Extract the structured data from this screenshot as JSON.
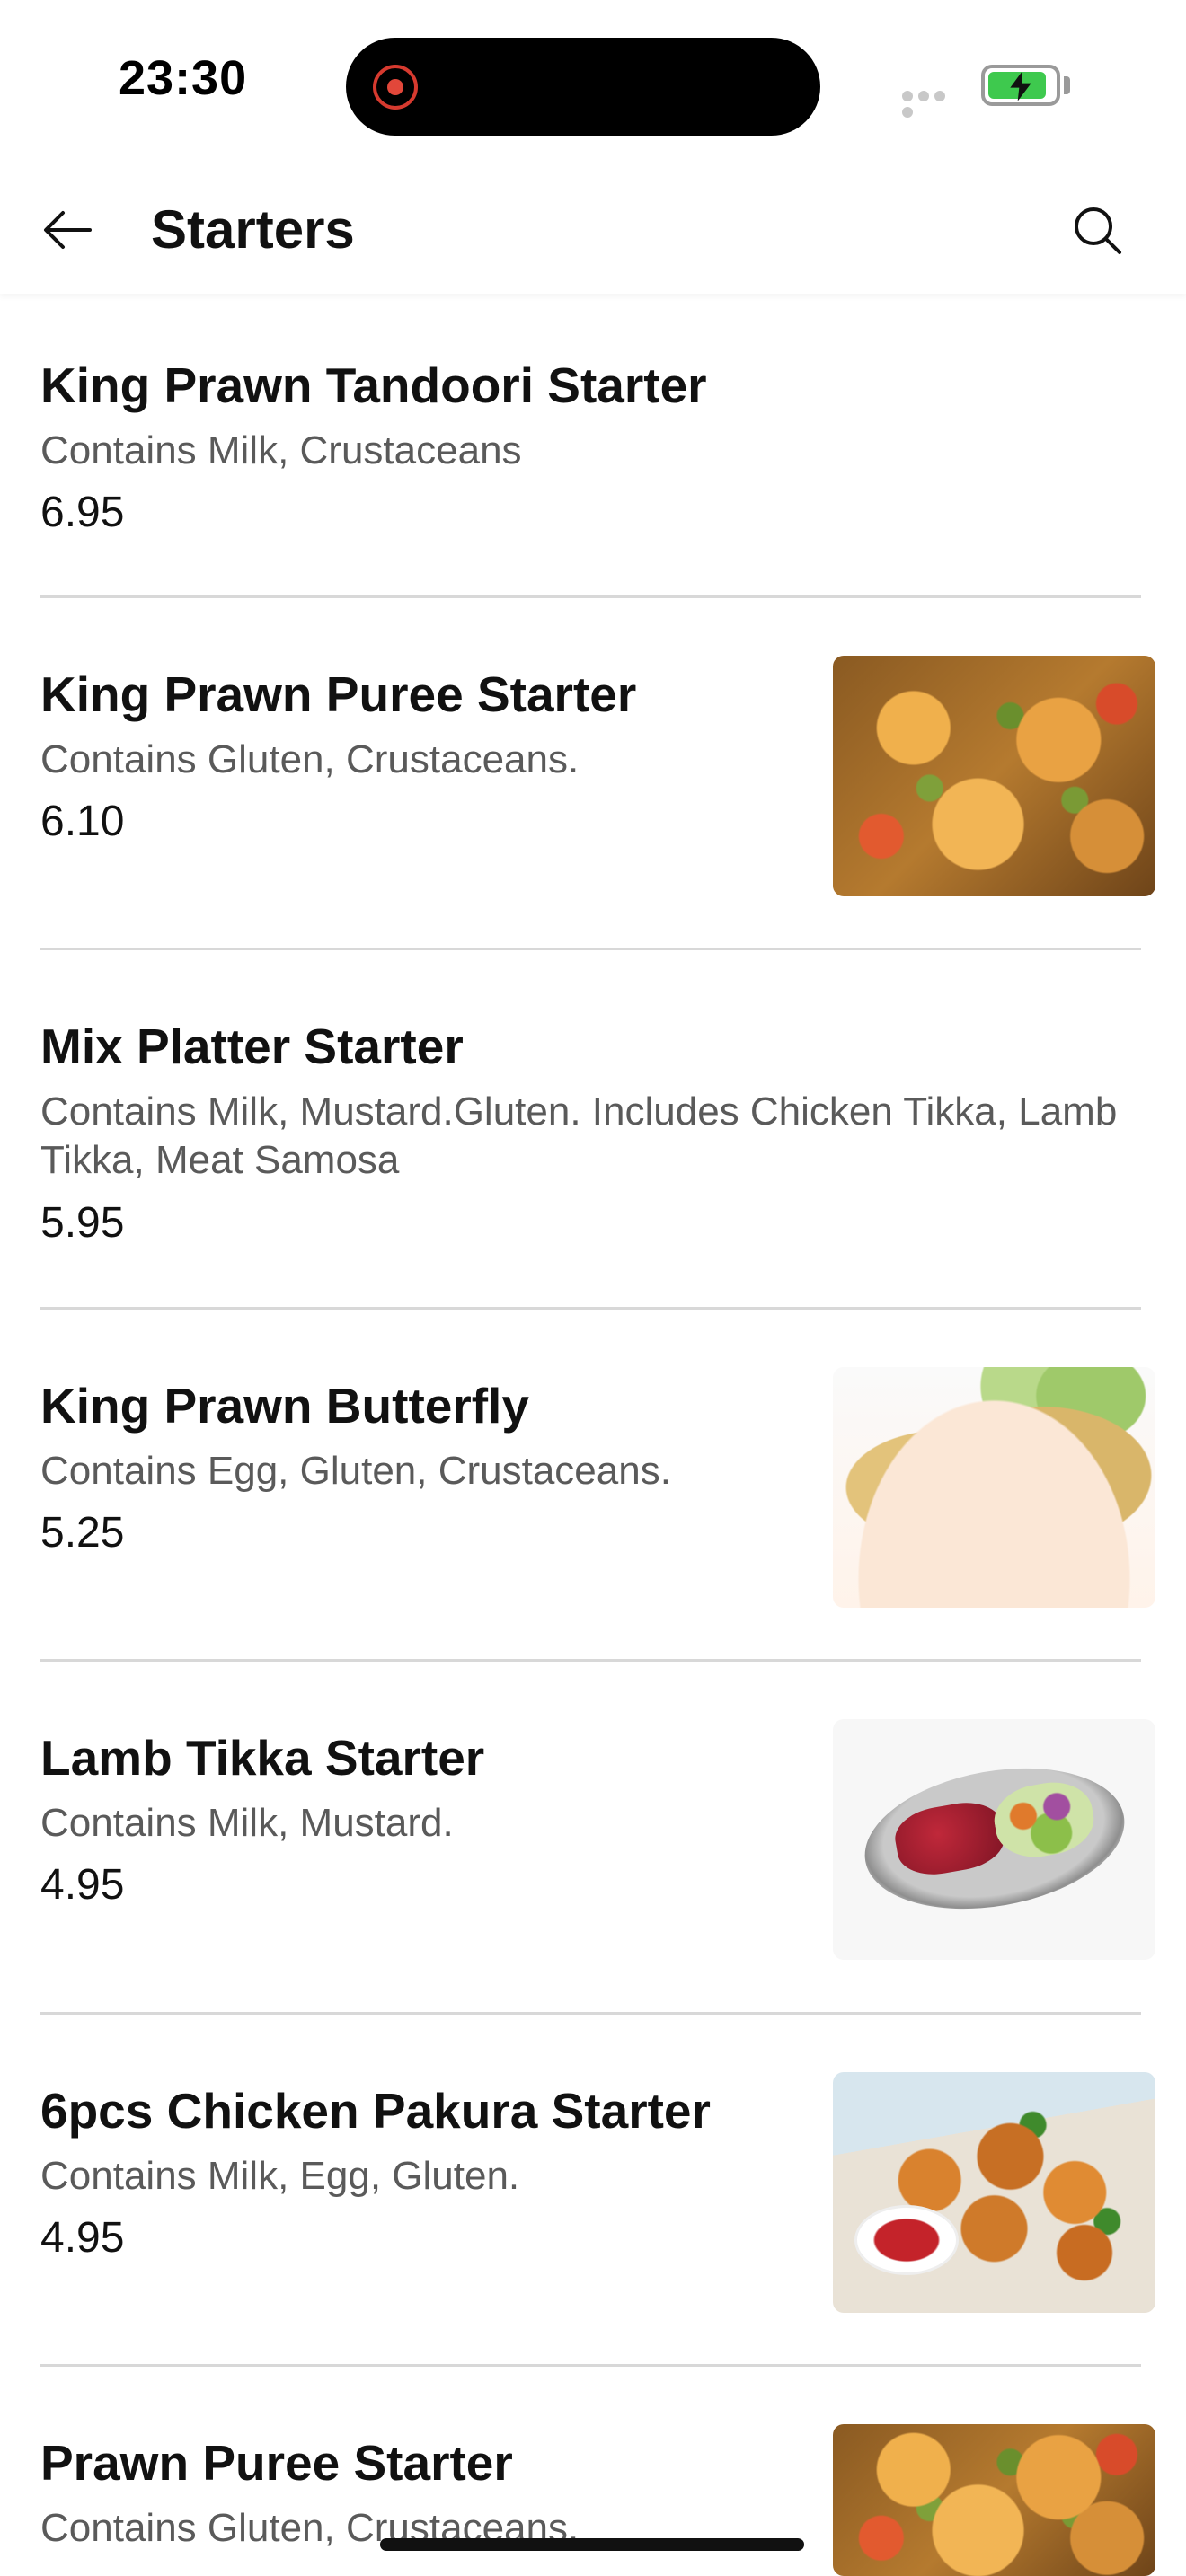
{
  "status_bar": {
    "time": "23:30",
    "battery_charging": true,
    "battery_color": "#3ec94e",
    "recording_indicator_color": "#e2473a"
  },
  "header": {
    "title": "Starters",
    "back_icon": "arrow-left-icon",
    "search_icon": "search-icon"
  },
  "menu_items": [
    {
      "name": "King Prawn Tandoori Starter",
      "description": "Contains Milk, Crustaceans",
      "price": "6.95",
      "has_image": false
    },
    {
      "name": "King Prawn Puree Starter",
      "description": "Contains Gluten, Crustaceans.",
      "price": "6.10",
      "has_image": true
    },
    {
      "name": "Mix Platter Starter",
      "description": "Contains Milk, Mustard.Gluten. Includes Chicken Tikka, Lamb Tikka, Meat Samosa",
      "price": "5.95",
      "has_image": false
    },
    {
      "name": "King Prawn Butterfly",
      "description": "Contains Egg, Gluten, Crustaceans.",
      "price": "5.25",
      "has_image": true
    },
    {
      "name": "Lamb Tikka Starter",
      "description": "Contains Milk, Mustard.",
      "price": "4.95",
      "has_image": true
    },
    {
      "name": "6pcs Chicken Pakura Starter",
      "description": "Contains Milk, Egg, Gluten.",
      "price": "4.95",
      "has_image": true
    },
    {
      "name": "Prawn Puree Starter",
      "description": "Contains Gluten, Crustaceans.",
      "price": "",
      "has_image": true
    }
  ]
}
